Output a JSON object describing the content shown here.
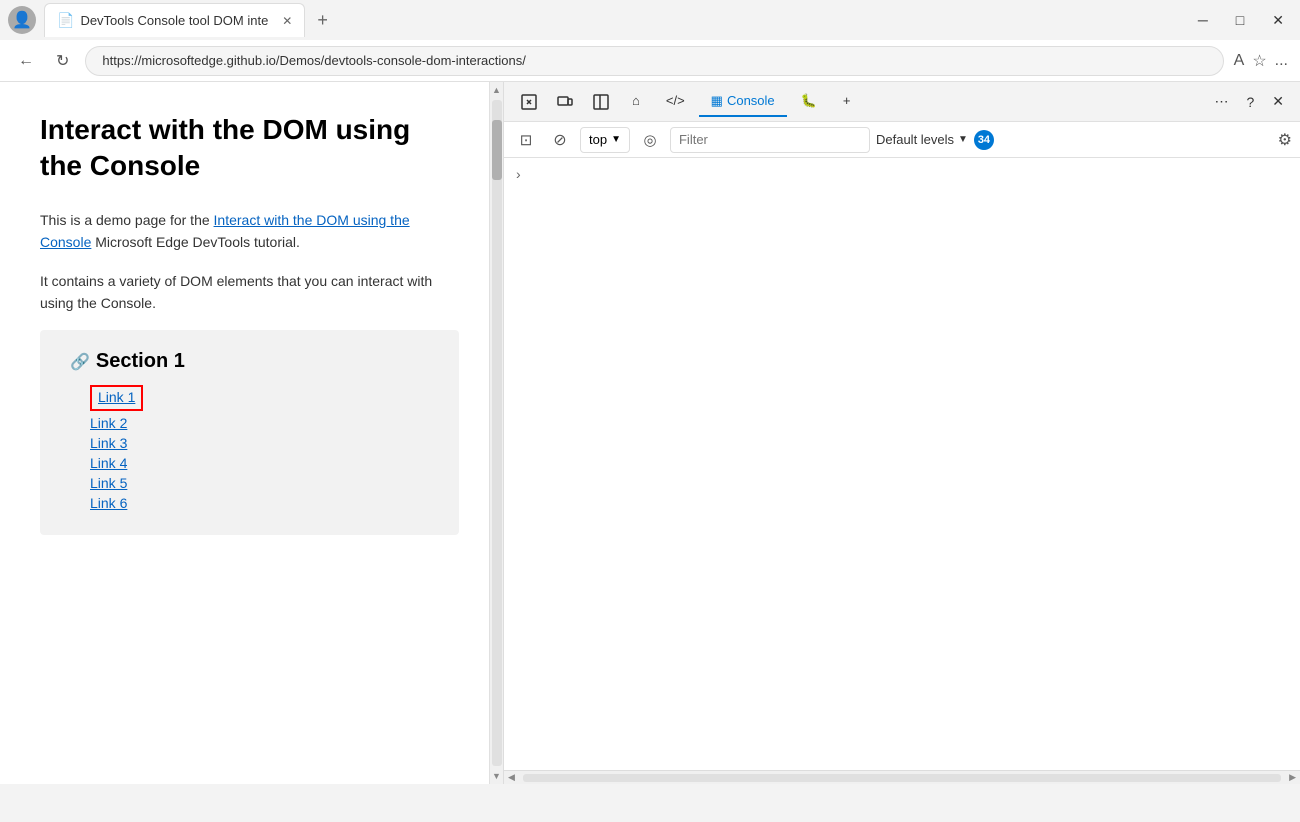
{
  "browser": {
    "profile_icon": "👤",
    "tab": {
      "icon": "📄",
      "title": "DevTools Console tool DOM inte",
      "close": "✕"
    },
    "new_tab": "+",
    "address": "https://microsoftedge.github.io/Demos/devtools-console-dom-interactions/",
    "window_controls": {
      "minimize": "─",
      "maximize": "□",
      "close": "✕"
    }
  },
  "nav": {
    "back": "←",
    "forward": "→",
    "refresh": "↻",
    "lock": "🔒",
    "translate": "A",
    "favorites": "☆",
    "more": "..."
  },
  "page": {
    "title": "Interact with the DOM using the Console",
    "paragraph1_prefix": "This is a demo page for the ",
    "paragraph1_link": "Interact with the DOM using the Console",
    "paragraph1_suffix": " Microsoft Edge DevTools tutorial.",
    "paragraph2": "It contains a variety of DOM elements that you can interact with using the Console.",
    "section1": {
      "anchor_icon": "🔗",
      "title": "Section 1",
      "links": [
        "Link 1",
        "Link 2",
        "Link 3",
        "Link 4",
        "Link 5",
        "Link 6"
      ]
    }
  },
  "devtools": {
    "tools": {
      "inspect": "⬚",
      "device": "⬚",
      "sidebar": "⬚",
      "home": "⌂",
      "elements": "</>",
      "console_icon": "▦",
      "console_label": "Console",
      "bug": "🐛",
      "add": "+",
      "more": "⋯",
      "help": "?",
      "close": "✕"
    },
    "console_toolbar": {
      "clear": "⊡",
      "block": "⊘",
      "context_top": "top",
      "context_dropdown": "▼",
      "eye": "◎",
      "filter_placeholder": "Filter",
      "default_levels": "Default levels",
      "default_levels_arrow": "▼",
      "message_count": "34",
      "settings": "⚙"
    },
    "console_area": {
      "chevron": "›"
    }
  }
}
